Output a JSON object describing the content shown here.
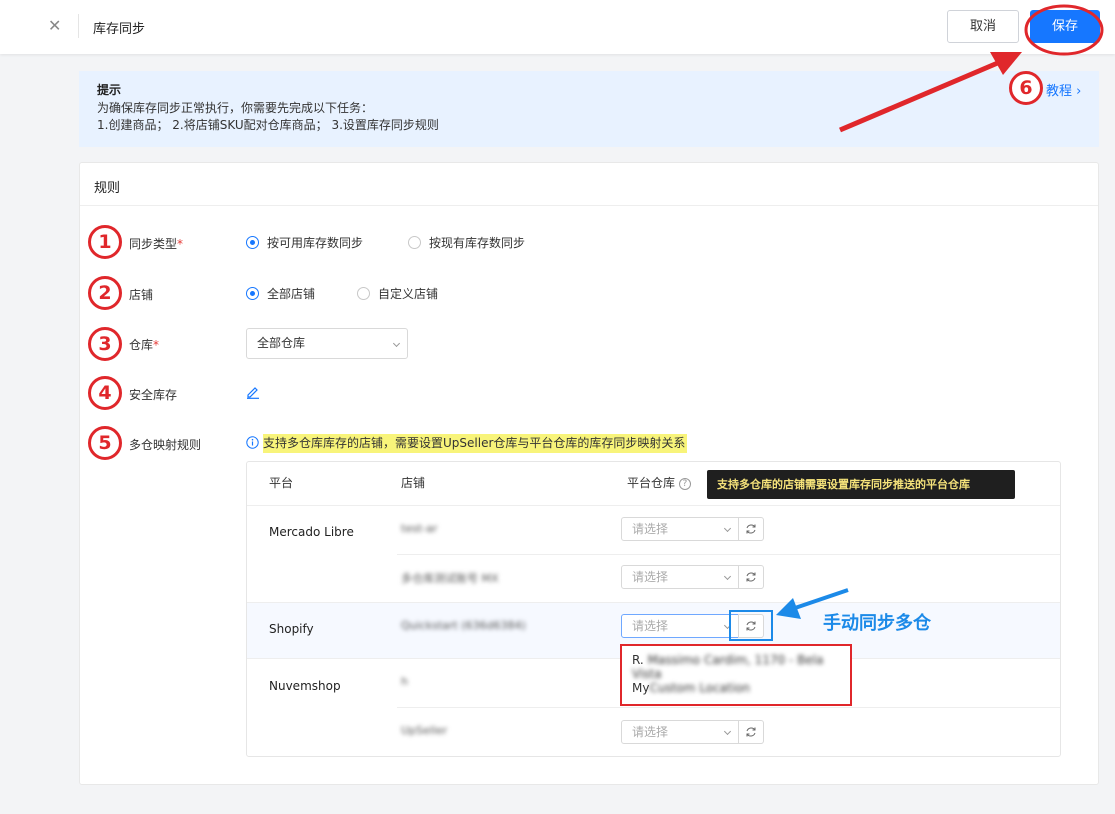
{
  "header": {
    "title": "库存同步",
    "cancel_label": "取消",
    "save_label": "保存"
  },
  "tip": {
    "title": "提示",
    "line1": "为确保库存同步正常执行，你需要先完成以下任务：",
    "line2": "1.创建商品；  2.将店铺SKU配对仓库商品；  3.设置库存同步规则",
    "tutorial_label": "教程"
  },
  "rules": {
    "heading": "规则",
    "sync_type": {
      "label": "同步类型",
      "required_mark": "*",
      "options": [
        "按可用库存数同步",
        "按现有库存数同步"
      ],
      "selected": 0
    },
    "store": {
      "label": "店铺",
      "options": [
        "全部店铺",
        "自定义店铺"
      ],
      "selected": 0
    },
    "warehouse": {
      "label": "仓库",
      "required_mark": "*",
      "value": "全部仓库"
    },
    "safety_stock": {
      "label": "安全库存"
    },
    "multi_warehouse": {
      "label": "多仓映射规则",
      "note": "支持多仓库库存的店铺，需要设置UpSeller仓库与平台仓库的库存同步映射关系"
    }
  },
  "mapping_table": {
    "columns": [
      "平台",
      "店铺",
      "平台仓库"
    ],
    "tooltip": "支持多仓库的店铺需要设置库存同步推送的平台仓库",
    "select_placeholder": "请选择",
    "rows": [
      {
        "platform": "Mercado Libre",
        "store": "test-ar"
      },
      {
        "platform": "",
        "store": "多仓库测试账号 MX"
      },
      {
        "platform": "Shopify",
        "store": "Quickstart (636d6384)"
      },
      {
        "platform": "Nuvemshop",
        "store": "h"
      },
      {
        "platform": "",
        "store": "UpSeller"
      }
    ],
    "dropdown_options": [
      {
        "prefix": "R.",
        "rest": "Massimo Cardim, 1170 - Bela Vista"
      },
      {
        "prefix": "My",
        "rest": "Custom Location"
      }
    ]
  },
  "annotations": {
    "numbers": [
      "1",
      "2",
      "3",
      "4",
      "5",
      "6"
    ],
    "manual_sync": "手动同步多仓"
  },
  "colors": {
    "primary": "#1677ff",
    "annotation_red": "#e0272b",
    "annotation_blue": "#1c8ae8",
    "tip_bg": "#e8f2ff",
    "highlight": "#f8f47a"
  }
}
